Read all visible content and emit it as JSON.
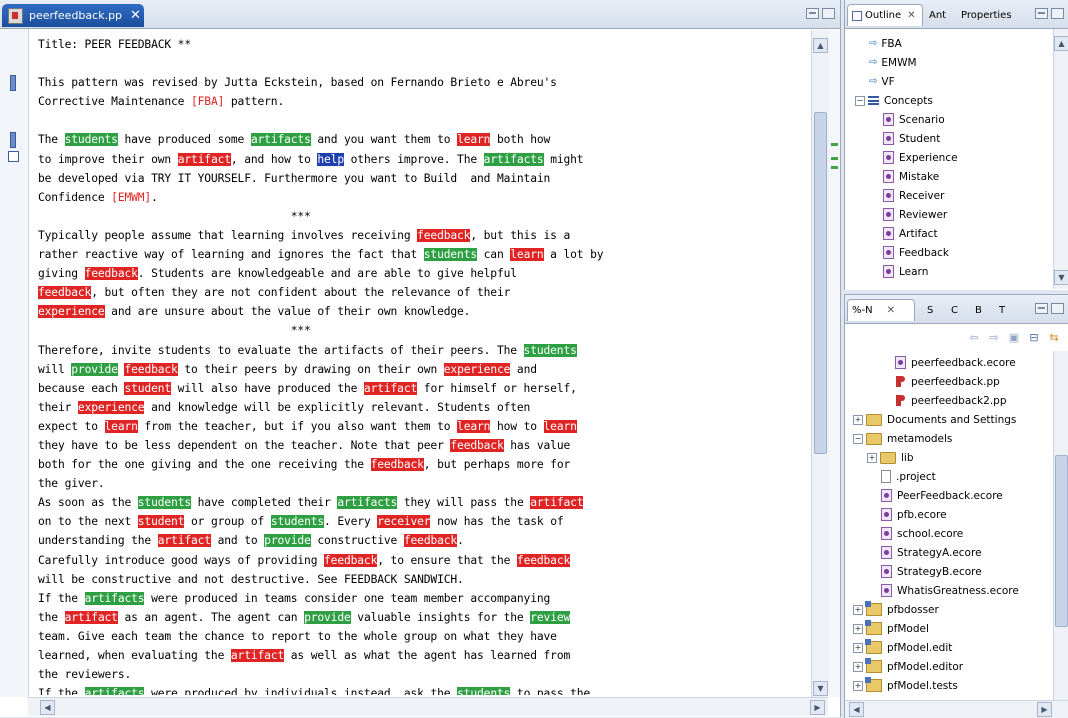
{
  "editor": {
    "tab_label": "peerfeedback.pp",
    "tab_close": "✕",
    "lines": [
      [
        {
          "t": "Title: PEER FEEDBACK **"
        }
      ],
      [
        {
          "t": ""
        }
      ],
      [
        {
          "t": "This pattern was revised by Jutta Eckstein, based on Fernando Brieto e Abreu's"
        }
      ],
      [
        {
          "t": "Corrective Maintenance "
        },
        {
          "t": "[FBA]",
          "c": "ref"
        },
        {
          "t": " pattern."
        }
      ],
      [
        {
          "t": ""
        }
      ],
      [
        {
          "t": "The "
        },
        {
          "t": "students",
          "c": "hg"
        },
        {
          "t": " have produced some "
        },
        {
          "t": "artifacts",
          "c": "hg"
        },
        {
          "t": " and you want them to "
        },
        {
          "t": "learn",
          "c": "hr"
        },
        {
          "t": " both how"
        }
      ],
      [
        {
          "t": "to improve their own "
        },
        {
          "t": "artifact",
          "c": "hr"
        },
        {
          "t": ", and how to "
        },
        {
          "t": "help",
          "c": "hb"
        },
        {
          "t": " others improve. The "
        },
        {
          "t": "artifacts",
          "c": "hg"
        },
        {
          "t": " might"
        }
      ],
      [
        {
          "t": "be developed via TRY IT YOURSELF. Furthermore you want to Build  and Maintain"
        }
      ],
      [
        {
          "t": "Confidence "
        },
        {
          "t": "[EMWM]",
          "c": "ref"
        },
        {
          "t": "."
        }
      ],
      [
        {
          "t": "                                      ***"
        }
      ],
      [
        {
          "t": "Typically people assume that learning involves receiving "
        },
        {
          "t": "feedback",
          "c": "hr"
        },
        {
          "t": ", but this is a"
        }
      ],
      [
        {
          "t": "rather reactive way of learning and ignores the fact that "
        },
        {
          "t": "students",
          "c": "hg"
        },
        {
          "t": " can "
        },
        {
          "t": "learn",
          "c": "hr"
        },
        {
          "t": " a lot by"
        }
      ],
      [
        {
          "t": "giving "
        },
        {
          "t": "feedback",
          "c": "hr"
        },
        {
          "t": ". Students are knowledgeable and are able to give helpful"
        }
      ],
      [
        {
          "t": "feedback",
          "c": "hr"
        },
        {
          "t": ", but often they are not confident about the relevance of their"
        }
      ],
      [
        {
          "t": "experience",
          "c": "hr"
        },
        {
          "t": " and are unsure about the value of their own knowledge."
        }
      ],
      [
        {
          "t": "                                      ***"
        }
      ],
      [
        {
          "t": "Therefore, invite students to evaluate the artifacts of their peers. The "
        },
        {
          "t": "students",
          "c": "hg"
        }
      ],
      [
        {
          "t": "will "
        },
        {
          "t": "provide",
          "c": "hg"
        },
        {
          "t": " "
        },
        {
          "t": "feedback",
          "c": "hr"
        },
        {
          "t": " to their peers by drawing on their own "
        },
        {
          "t": "experience",
          "c": "hr"
        },
        {
          "t": " and"
        }
      ],
      [
        {
          "t": "because each "
        },
        {
          "t": "student",
          "c": "hr"
        },
        {
          "t": " will also have produced the "
        },
        {
          "t": "artifact",
          "c": "hr"
        },
        {
          "t": " for himself or herself,"
        }
      ],
      [
        {
          "t": "their "
        },
        {
          "t": "experience",
          "c": "hr"
        },
        {
          "t": " and knowledge will be explicitly relevant. Students often"
        }
      ],
      [
        {
          "t": "expect to "
        },
        {
          "t": "learn",
          "c": "hr"
        },
        {
          "t": " from the teacher, but if you also want them to "
        },
        {
          "t": "learn",
          "c": "hr"
        },
        {
          "t": " how to "
        },
        {
          "t": "learn",
          "c": "hr"
        }
      ],
      [
        {
          "t": "they have to be less dependent on the teacher. Note that peer "
        },
        {
          "t": "feedback",
          "c": "hr"
        },
        {
          "t": " has value"
        }
      ],
      [
        {
          "t": "both for the one giving and the one receiving the "
        },
        {
          "t": "feedback",
          "c": "hr"
        },
        {
          "t": ", but perhaps more for"
        }
      ],
      [
        {
          "t": "the giver."
        }
      ],
      [
        {
          "t": "As soon as the "
        },
        {
          "t": "students",
          "c": "hg"
        },
        {
          "t": " have completed their "
        },
        {
          "t": "artifacts",
          "c": "hg"
        },
        {
          "t": " they will pass the "
        },
        {
          "t": "artifact",
          "c": "hr"
        }
      ],
      [
        {
          "t": "on to the next "
        },
        {
          "t": "student",
          "c": "hr"
        },
        {
          "t": " or group of "
        },
        {
          "t": "students",
          "c": "hg"
        },
        {
          "t": ". Every "
        },
        {
          "t": "receiver",
          "c": "hr"
        },
        {
          "t": " now has the task of"
        }
      ],
      [
        {
          "t": "understanding the "
        },
        {
          "t": "artifact",
          "c": "hr"
        },
        {
          "t": " and to "
        },
        {
          "t": "provide",
          "c": "hg"
        },
        {
          "t": " constructive "
        },
        {
          "t": "feedback",
          "c": "hr"
        },
        {
          "t": "."
        }
      ],
      [
        {
          "t": "Carefully introduce good ways of providing "
        },
        {
          "t": "feedback",
          "c": "hr"
        },
        {
          "t": ", to ensure that the "
        },
        {
          "t": "feedback",
          "c": "hr"
        }
      ],
      [
        {
          "t": "will be constructive and not destructive. See FEEDBACK SANDWICH."
        }
      ],
      [
        {
          "t": "If the "
        },
        {
          "t": "artifacts",
          "c": "hg"
        },
        {
          "t": " were produced in teams consider one team member accompanying"
        }
      ],
      [
        {
          "t": "the "
        },
        {
          "t": "artifact",
          "c": "hr"
        },
        {
          "t": " as an agent. The agent can "
        },
        {
          "t": "provide",
          "c": "hg"
        },
        {
          "t": " valuable insights for the "
        },
        {
          "t": "review",
          "c": "hg"
        }
      ],
      [
        {
          "t": "team. Give each team the chance to report to the whole group on what they have"
        }
      ],
      [
        {
          "t": "learned, when evaluating the "
        },
        {
          "t": "artifact",
          "c": "hr"
        },
        {
          "t": " as well as what the agent has learned from"
        }
      ],
      [
        {
          "t": "the reviewers."
        }
      ],
      [
        {
          "t": "If the "
        },
        {
          "t": "artifacts",
          "c": "hg"
        },
        {
          "t": " were produced by individuals instead, ask the "
        },
        {
          "t": "students",
          "c": "hg"
        },
        {
          "t": " to pass the"
        }
      ]
    ]
  },
  "outline": {
    "tabs": [
      "Outline",
      "Ant",
      "Properties"
    ],
    "tab_close": "✕",
    "items": [
      {
        "label": "FBA",
        "kind": "ref",
        "indent": 1
      },
      {
        "label": "EMWM",
        "kind": "ref",
        "indent": 1
      },
      {
        "label": "VF",
        "kind": "ref",
        "indent": 1
      },
      {
        "label": "Concepts",
        "kind": "group",
        "indent": 0
      },
      {
        "label": "Scenario",
        "kind": "concept",
        "indent": 2
      },
      {
        "label": "Student",
        "kind": "concept",
        "indent": 2
      },
      {
        "label": "Experience",
        "kind": "concept",
        "indent": 2
      },
      {
        "label": "Mistake",
        "kind": "concept",
        "indent": 2
      },
      {
        "label": "Receiver",
        "kind": "concept",
        "indent": 2
      },
      {
        "label": "Reviewer",
        "kind": "concept",
        "indent": 2
      },
      {
        "label": "Artifact",
        "kind": "concept",
        "indent": 2
      },
      {
        "label": "Feedback",
        "kind": "concept",
        "indent": 2
      },
      {
        "label": "Learn",
        "kind": "concept",
        "indent": 2
      }
    ]
  },
  "navigator": {
    "tabs": [
      "%-N",
      "S",
      "C",
      "B",
      "T"
    ],
    "tab_close": "✕",
    "items": [
      {
        "label": "peerfeedback.ecore",
        "kind": "ecore",
        "indent": 3,
        "exp": ""
      },
      {
        "label": "peerfeedback.pp",
        "kind": "pp",
        "indent": 3,
        "exp": ""
      },
      {
        "label": "peerfeedback2.pp",
        "kind": "pp",
        "indent": 3,
        "exp": ""
      },
      {
        "label": "Documents and Settings",
        "kind": "folder",
        "indent": 0,
        "exp": "+"
      },
      {
        "label": "metamodels",
        "kind": "folder",
        "indent": 0,
        "exp": "-"
      },
      {
        "label": "lib",
        "kind": "folder",
        "indent": 1,
        "exp": "+"
      },
      {
        "label": ".project",
        "kind": "file",
        "indent": 2,
        "exp": ""
      },
      {
        "label": "PeerFeedback.ecore",
        "kind": "ecore",
        "indent": 2,
        "exp": ""
      },
      {
        "label": "pfb.ecore",
        "kind": "ecore",
        "indent": 2,
        "exp": ""
      },
      {
        "label": "school.ecore",
        "kind": "ecore",
        "indent": 2,
        "exp": ""
      },
      {
        "label": "StrategyA.ecore",
        "kind": "ecore",
        "indent": 2,
        "exp": ""
      },
      {
        "label": "StrategyB.ecore",
        "kind": "ecore",
        "indent": 2,
        "exp": ""
      },
      {
        "label": "WhatisGreatness.ecore",
        "kind": "ecore",
        "indent": 2,
        "exp": ""
      },
      {
        "label": "pfbdosser",
        "kind": "project",
        "indent": 0,
        "exp": "+"
      },
      {
        "label": "pfModel",
        "kind": "project",
        "indent": 0,
        "exp": "+"
      },
      {
        "label": "pfModel.edit",
        "kind": "project",
        "indent": 0,
        "exp": "+"
      },
      {
        "label": "pfModel.editor",
        "kind": "project",
        "indent": 0,
        "exp": "+"
      },
      {
        "label": "pfModel.tests",
        "kind": "project",
        "indent": 0,
        "exp": "+"
      }
    ]
  }
}
